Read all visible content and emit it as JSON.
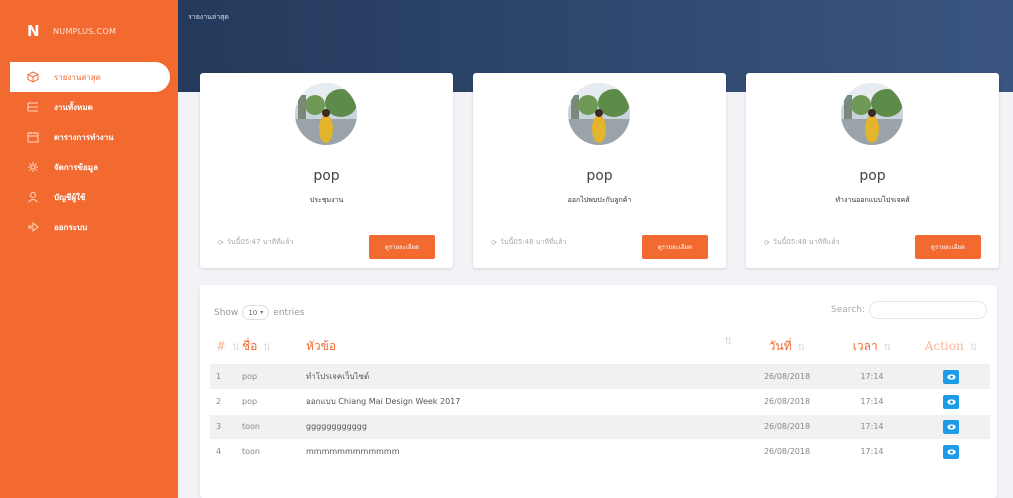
{
  "sidebar": {
    "brand_logo": "N",
    "brand_name": "NUMPLUS.COM",
    "items": [
      {
        "label": "รายงานล่าสุด",
        "icon": "cube-icon",
        "active": true
      },
      {
        "label": "งานทั้งหมด",
        "icon": "list-icon"
      },
      {
        "label": "ตารางการทำงาน",
        "icon": "calendar-icon"
      },
      {
        "label": "จัดการข้อมูล",
        "icon": "gear-icon"
      },
      {
        "label": "บัญชีผู้ใช้",
        "icon": "user-icon"
      },
      {
        "label": "ออกระบบ",
        "icon": "logout-icon"
      }
    ]
  },
  "header": {
    "title": "รายงานล่าสุด"
  },
  "cards": [
    {
      "name": "pop",
      "subtitle": "ประชุมงาน",
      "time": "วันนี้05:47 นาทีที่แล้ว",
      "button": "ดูรายละเอียด"
    },
    {
      "name": "pop",
      "subtitle": "ออกไปพบปะกับลูกค้า",
      "time": "วันนี้05:48 นาทีที่แล้ว",
      "button": "ดูรายละเอียด"
    },
    {
      "name": "pop",
      "subtitle": "ทำงานออกแบบโปรเจคส์",
      "time": "วันนี้05:48 นาทีที่แล้ว",
      "button": "ดูรายละเอียด"
    }
  ],
  "table": {
    "show_label": "Show",
    "entries_value": "10",
    "entries_label": "entries",
    "search_label": "Search:",
    "columns": [
      "#",
      "ชื่อ",
      "หัวข้อ",
      "วันที่",
      "เวลา",
      "Action"
    ],
    "rows": [
      {
        "no": "1",
        "name": "pop",
        "topic": "ทำโปรเจคเว็บไซต์",
        "date": "26/08/2018",
        "time": "17:14"
      },
      {
        "no": "2",
        "name": "pop",
        "topic": "ออกแบบ Chiang Mai Design Week 2017",
        "date": "26/08/2018",
        "time": "17:14"
      },
      {
        "no": "3",
        "name": "toon",
        "topic": "gggggggggggg",
        "date": "26/08/2018",
        "time": "17:14"
      },
      {
        "no": "4",
        "name": "toon",
        "topic": "mmmmmmmmmmmm",
        "date": "26/08/2018",
        "time": "17:14"
      }
    ]
  },
  "colors": {
    "accent": "#f26a30",
    "header": "#2c4468",
    "view_button": "#1e9be8"
  }
}
